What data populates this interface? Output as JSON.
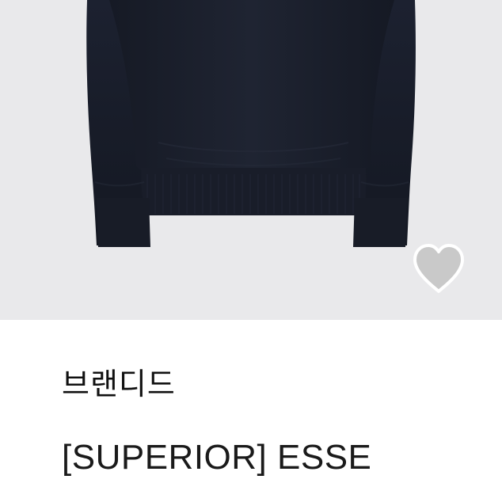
{
  "product": {
    "brand": "브랜디드",
    "name": "[SUPERIOR] ESSE",
    "image_icon": "product-image",
    "wishlist_icon": "heart-icon"
  },
  "colors": {
    "image_background": "#e9e9eb",
    "garment": "#1b1f2b",
    "heart": "#c9c9c9",
    "text": "#111111"
  }
}
